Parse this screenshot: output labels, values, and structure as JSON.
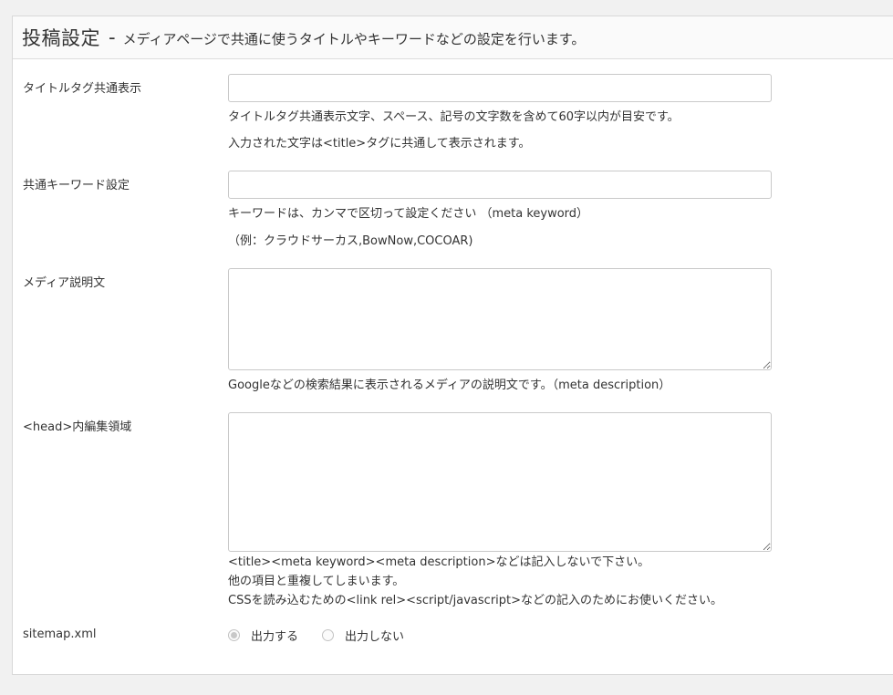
{
  "header": {
    "title": "投稿設定",
    "dash": "-",
    "subtitle": "メディアページで共通に使うタイトルやキーワードなどの設定を行います。"
  },
  "fields": {
    "title_tag": {
      "label": "タイトルタグ共通表示",
      "value": "",
      "help1": "タイトルタグ共通表示文字、スペース、記号の文字数を含めて60字以内が目安です。",
      "help2": "入力された文字は<title>タグに共通して表示されます。"
    },
    "keywords": {
      "label": "共通キーワード設定",
      "value": "",
      "help1": "キーワードは、カンマで区切って設定ください （meta keyword）",
      "help2": "（例：クラウドサーカス,BowNow,COCOAR)"
    },
    "description": {
      "label": "メディア説明文",
      "value": "",
      "help1": "Googleなどの検索結果に表示されるメディアの説明文です。（meta description）"
    },
    "head_edit": {
      "label": "<head>内編集領域",
      "value": "",
      "help1": "<title><meta keyword><meta description>などは記入しないで下さい。",
      "help2": "他の項目と重複してしまいます。",
      "help3": "CSSを読み込むための<link rel><script/javascript>などの記入のためにお使いください。"
    },
    "sitemap": {
      "label": "sitemap.xml",
      "options": [
        {
          "label": "出力する",
          "checked": true
        },
        {
          "label": "出力しない",
          "checked": false
        }
      ]
    }
  }
}
